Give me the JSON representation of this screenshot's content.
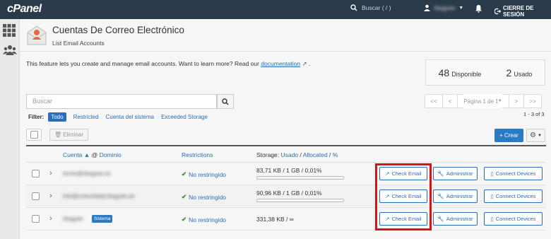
{
  "topbar": {
    "logo": "cPanel",
    "search_placeholder": "Buscar ( / )",
    "username": "rbsgyee",
    "logout_label": "CIERRE DE SESIÓN"
  },
  "header": {
    "title": "Cuentas De Correo Electrónico",
    "subtitle": "List Email Accounts"
  },
  "intro": {
    "text": "This feature lets you create and manage email accounts. Want to learn more? Read our",
    "link_label": "documentation",
    "suffix": "."
  },
  "stats": {
    "available_count": "48",
    "available_label": "Disponible",
    "used_count": "2",
    "used_label": "Usado"
  },
  "search": {
    "placeholder": "Buscar"
  },
  "pagination": {
    "first": "<<",
    "prev": "<",
    "page_label": "Página 1 de 1",
    "next": ">",
    "last": ">>",
    "range": "1 - 3 of 3"
  },
  "filter": {
    "label": "Filter:",
    "options": [
      "Todo",
      "Restricted",
      "Cuenta del sistema",
      "Exceeded Storage"
    ]
  },
  "toolbar": {
    "delete_label": "Eliminar",
    "create_label": "Crear"
  },
  "table": {
    "headers": {
      "account": "Cuenta",
      "domain": "Dominio",
      "restrictions": "Restrictions",
      "storage": "Storage:",
      "used": "Usado",
      "allocated": "Allocated",
      "percent": "%"
    },
    "rows": [
      {
        "account": "torres@rbsgyee.es",
        "badge": "",
        "restriction": "No restringido",
        "usage": "83,71 KB / 1 GB / 0,01%"
      },
      {
        "account": "info@comunidad.rbsgyee.es",
        "badge": "",
        "restriction": "No restringido",
        "usage": "90,96 KB / 1 GB / 0,01%"
      },
      {
        "account": "rbsgyee",
        "badge": "Sistema",
        "restriction": "No restringido",
        "usage": "331,38 KB / ∞"
      }
    ],
    "actions": {
      "check_email": "Check Email",
      "manage": "Administrar",
      "devices": "Connect Devices"
    }
  },
  "colors": {
    "topbar": "#293a4a",
    "accent": "#2a6ebb",
    "highlight": "#d6131c"
  }
}
